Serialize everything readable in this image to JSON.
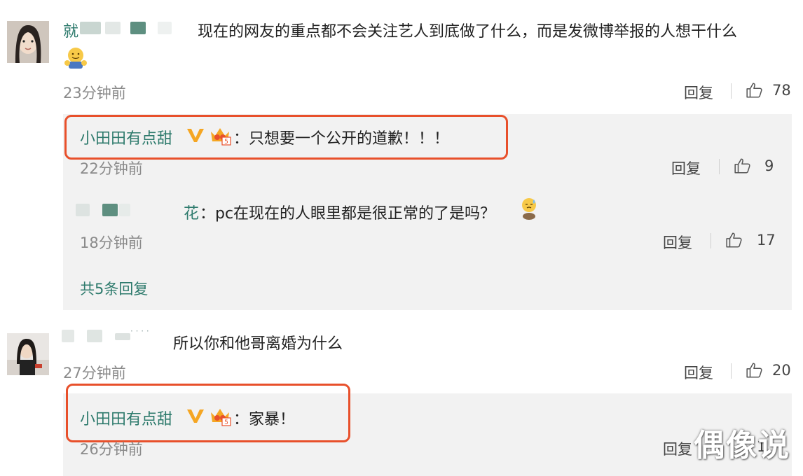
{
  "comments": [
    {
      "user_visible": "就",
      "text": "现在的网友的重点都不会关注艺人到底做了什么，而是发微博举报的人想干什么",
      "time": "23分钟前",
      "reply_label": "回复",
      "likes": "78",
      "replies": [
        {
          "user": "小田田有点甜",
          "text": "：只想要一个公开的道歉！！！",
          "time": "22分钟前",
          "reply_label": "回复",
          "likes": "9"
        },
        {
          "user_visible": "花",
          "text": "：pc在现在的人眼里都是很正常的了是吗？",
          "time": "18分钟前",
          "reply_label": "回复",
          "likes": "17"
        }
      ],
      "more_replies": "共5条回复"
    },
    {
      "user_visible": "· · · ·",
      "text": "所以你和他哥离婚为什么",
      "time": "27分钟前",
      "reply_label": "回复",
      "likes": "20",
      "replies": [
        {
          "user": "小田田有点甜",
          "text": "：家暴！",
          "time": "26分钟前",
          "reply_label": "回复",
          "likes": "1"
        }
      ]
    }
  ],
  "watermark": "偶像说",
  "colors": {
    "username": "#2d7a6c",
    "highlight": "#e8502b",
    "reply_bg": "#f2f2f2",
    "vip_gold": "#f5a623"
  },
  "icons": [
    "thumbs-up-icon",
    "verified-v-icon",
    "member-crown-icon",
    "emoji-hug-icon",
    "emoji-sweat-icon"
  ]
}
